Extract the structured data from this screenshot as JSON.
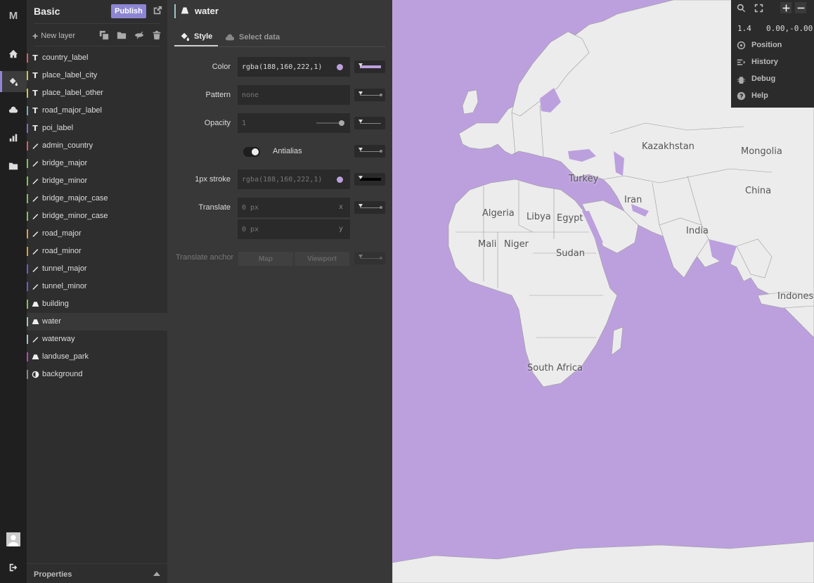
{
  "rail": {
    "logo": "M"
  },
  "layers_panel": {
    "title": "Basic",
    "publish_label": "Publish",
    "new_layer_label": "New layer",
    "items": [
      {
        "name": "country_label",
        "type": "T",
        "color": "#e25c5c"
      },
      {
        "name": "place_label_city",
        "type": "T",
        "color": "#c9c94a"
      },
      {
        "name": "place_label_other",
        "type": "T",
        "color": "#c9c94a"
      },
      {
        "name": "road_major_label",
        "type": "T",
        "color": "#6fb0c8"
      },
      {
        "name": "poi_label",
        "type": "T",
        "color": "#7a6fd0"
      },
      {
        "name": "admin_country",
        "type": "line",
        "color": "#e25c5c"
      },
      {
        "name": "bridge_major",
        "type": "line",
        "color": "#7ec84a"
      },
      {
        "name": "bridge_minor",
        "type": "line",
        "color": "#7ec84a"
      },
      {
        "name": "bridge_major_case",
        "type": "line",
        "color": "#7ec84a"
      },
      {
        "name": "bridge_minor_case",
        "type": "line",
        "color": "#7ec84a"
      },
      {
        "name": "road_major",
        "type": "line",
        "color": "#e0a040"
      },
      {
        "name": "road_minor",
        "type": "line",
        "color": "#e0a040"
      },
      {
        "name": "tunnel_major",
        "type": "line",
        "color": "#6a5cd0"
      },
      {
        "name": "tunnel_minor",
        "type": "line",
        "color": "#6a5cd0"
      },
      {
        "name": "building",
        "type": "fill",
        "color": "#7ec84a"
      },
      {
        "name": "water",
        "type": "fill",
        "color": "#9ec5c6"
      },
      {
        "name": "waterway",
        "type": "line",
        "color": "#9ec5c6"
      },
      {
        "name": "landuse_park",
        "type": "fill",
        "color": "#c040c0"
      },
      {
        "name": "background",
        "type": "bg",
        "color": "#888888"
      }
    ],
    "active_index": 15,
    "footer_label": "Properties"
  },
  "style_panel": {
    "layer_title": "water",
    "tabs": {
      "style": "Style",
      "select_data": "Select data"
    },
    "color_label": "Color",
    "color_value": "rgba(188,160,222,1)",
    "pattern_label": "Pattern",
    "pattern_placeholder": "none",
    "opacity_label": "Opacity",
    "opacity_value": "1",
    "antialias_label": "Antialias",
    "antialias_on": true,
    "stroke_label": "1px stroke",
    "stroke_value": "rgba(188,160,222,1)",
    "translate_label": "Translate",
    "translate_x": "0 px",
    "translate_y": "0 px",
    "unit_x": "x",
    "unit_y": "y",
    "translate_anchor_label": "Translate anchor",
    "anchor_map": "Map",
    "anchor_viewport": "Viewport",
    "accent_color": "#bca0de"
  },
  "map": {
    "labels": [
      "Kazakhstan",
      "Mongolia",
      "Turkey",
      "China",
      "Iran",
      "Algeria",
      "Libya",
      "Egypt",
      "India",
      "Mali",
      "Niger",
      "Sudan",
      "Indones",
      "South Africa"
    ],
    "water_color": "#bca0de",
    "land_color": "#ececec"
  },
  "map_controls": {
    "zoom": "1.4",
    "coords": "0.00,-0.00",
    "items": [
      "Position",
      "History",
      "Debug",
      "Help"
    ]
  }
}
